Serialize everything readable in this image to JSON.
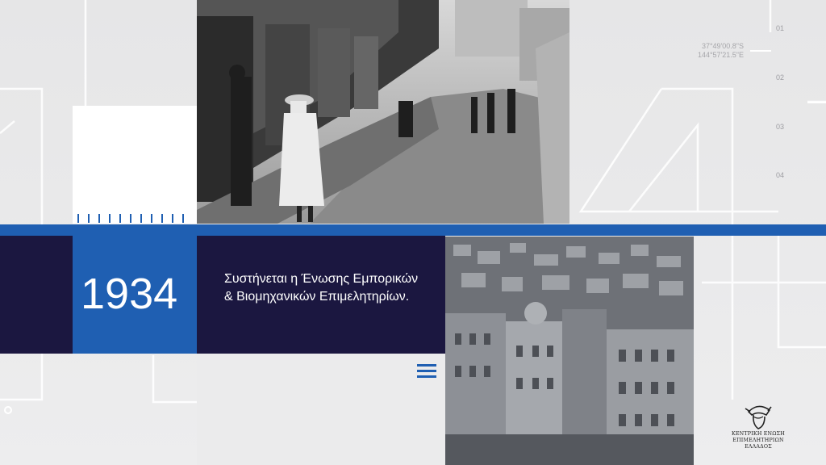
{
  "timeline": {
    "year": "1934",
    "caption_lines": [
      "Συστήνεται η Ένωσης Εμπορικών",
      "& Βιομηχανικών Επιμελητηρίων."
    ],
    "index_numbers": [
      "01",
      "02",
      "03",
      "04"
    ]
  },
  "coordinates": {
    "line1": "37°49'00.8\"S",
    "line2": "144°57'21.5\"E"
  },
  "logo": {
    "line1": "ΚΕΝΤΡΙΚΗ ΕΝΩΣΗ",
    "line2": "ΕΠΙΜΕΛΗΤΗΡΙΩΝ",
    "line3": "ΕΛΛΑΔΟΣ"
  },
  "icons": {
    "menu": "hamburger-menu-icon",
    "logo": "hermes-head-icon"
  },
  "colors": {
    "accent_blue": "#1f5fb2",
    "navy": "#1b1740",
    "background": "#e9e9ea"
  }
}
